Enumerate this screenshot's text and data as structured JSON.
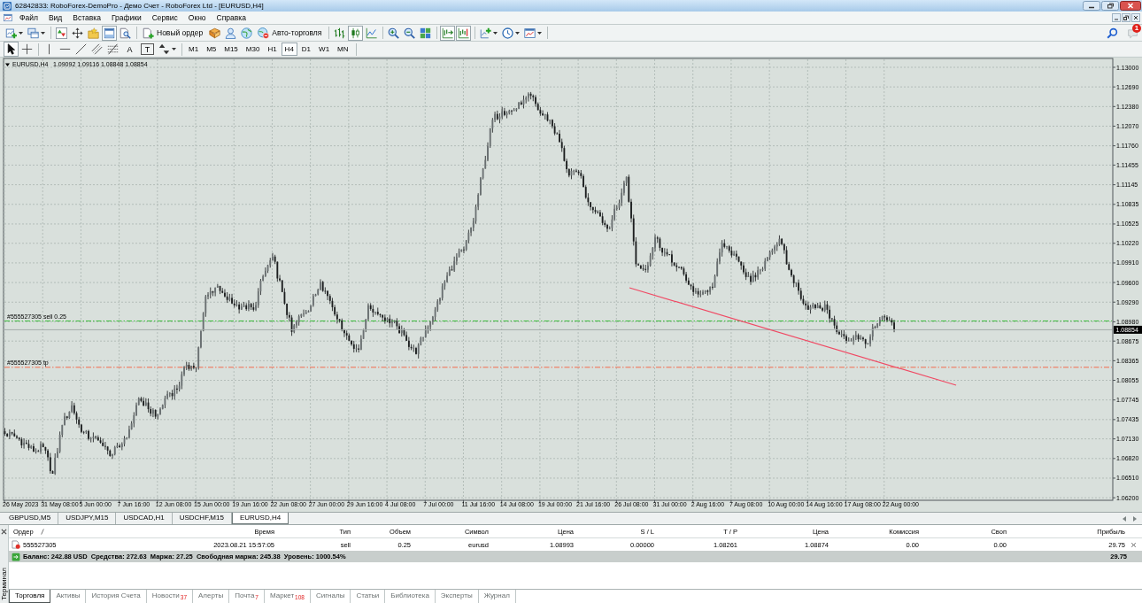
{
  "window": {
    "title": "62842833: RoboForex-DemoPro - Демо Счет - RoboForex Ltd - [EURUSD,H4]"
  },
  "menu": [
    "Файл",
    "Вид",
    "Вставка",
    "Графики",
    "Сервис",
    "Окно",
    "Справка"
  ],
  "main_toolbar": [
    {
      "kind": "icon",
      "pressed": false,
      "dropdown": true
    },
    {
      "kind": "icon",
      "pressed": false,
      "dropdown": true
    },
    {
      "kind": "separator"
    },
    {
      "kind": "icon",
      "pressed": false,
      "dropdown": false
    },
    {
      "kind": "icon",
      "pressed": false,
      "dropdown": false
    },
    {
      "kind": "icon",
      "pressed": false,
      "dropdown": false
    },
    {
      "kind": "icon",
      "pressed": true,
      "dropdown": false
    },
    {
      "kind": "icon",
      "pressed": false,
      "dropdown": false
    },
    {
      "kind": "separator"
    },
    {
      "kind": "text",
      "label": "Новый ордер",
      "pressed": false,
      "dropdown": false
    },
    {
      "kind": "icon",
      "pressed": false,
      "dropdown": false
    },
    {
      "kind": "icon",
      "pressed": false,
      "dropdown": false
    },
    {
      "kind": "icon",
      "pressed": false,
      "dropdown": false
    },
    {
      "kind": "text",
      "label": "Авто-торговля",
      "pressed": false,
      "dropdown": false
    },
    {
      "kind": "separator"
    },
    {
      "kind": "icon",
      "pressed": false,
      "dropdown": false
    },
    {
      "kind": "icon",
      "pressed": true,
      "dropdown": false
    },
    {
      "kind": "icon",
      "pressed": false,
      "dropdown": false
    },
    {
      "kind": "separator"
    },
    {
      "kind": "icon",
      "pressed": false,
      "dropdown": false
    },
    {
      "kind": "icon",
      "pressed": false,
      "dropdown": false
    },
    {
      "kind": "icon",
      "pressed": false,
      "dropdown": false
    },
    {
      "kind": "separator"
    },
    {
      "kind": "icon",
      "pressed": true,
      "dropdown": false
    },
    {
      "kind": "icon",
      "pressed": true,
      "dropdown": false
    },
    {
      "kind": "separator"
    },
    {
      "kind": "icon",
      "pressed": false,
      "dropdown": true
    },
    {
      "kind": "icon",
      "pressed": false,
      "dropdown": true
    },
    {
      "kind": "icon",
      "pressed": false,
      "dropdown": true
    },
    {
      "kind": "separator"
    }
  ],
  "notifications": {
    "count": "1"
  },
  "drawing_toolbar": [
    {
      "kind": "icon",
      "pressed": true,
      "dropdown": false
    },
    {
      "kind": "icon",
      "pressed": false,
      "dropdown": false
    },
    {
      "kind": "separator"
    },
    {
      "kind": "icon",
      "pressed": false,
      "dropdown": false
    },
    {
      "kind": "icon",
      "pressed": false,
      "dropdown": false
    },
    {
      "kind": "icon",
      "pressed": false,
      "dropdown": false
    },
    {
      "kind": "icon",
      "pressed": false,
      "dropdown": false
    },
    {
      "kind": "icon",
      "pressed": false,
      "dropdown": false
    },
    {
      "kind": "glyph",
      "label": "A",
      "pressed": false,
      "dropdown": false
    },
    {
      "kind": "boxed_glyph",
      "label": "T",
      "pressed": false,
      "dropdown": false
    },
    {
      "kind": "icon",
      "pressed": false,
      "dropdown": true
    },
    {
      "kind": "separator"
    }
  ],
  "timeframes": [
    {
      "label": "M1",
      "selected": false
    },
    {
      "label": "M5",
      "selected": false
    },
    {
      "label": "M15",
      "selected": false
    },
    {
      "label": "M30",
      "selected": false
    },
    {
      "label": "H1",
      "selected": false
    },
    {
      "label": "H4",
      "selected": true
    },
    {
      "label": "D1",
      "selected": false
    },
    {
      "label": "W1",
      "selected": false
    },
    {
      "label": "MN",
      "selected": false
    }
  ],
  "chart": {
    "ohlc": [
      "1.09092",
      "1.09116",
      "1.08848",
      "1.08854"
    ],
    "bid_price": "1.08854",
    "chart_data": {
      "type": "line",
      "title": "EURUSD,H4",
      "categories": [
        "26 May 2023",
        "31 May 08:00",
        "5 Jun 00:00",
        "7 Jun 16:00",
        "12 Jun 08:00",
        "15 Jun 00:00",
        "19 Jun 16:00",
        "22 Jun 08:00",
        "27 Jun 00:00",
        "29 Jun 16:00",
        "4 Jul 08:00",
        "7 Jul 00:00",
        "11 Jul 16:00",
        "14 Jul 08:00",
        "19 Jul 00:00",
        "21 Jul 16:00",
        "26 Jul 08:00",
        "31 Jul 00:00",
        "2 Aug 16:00",
        "7 Aug 08:00",
        "10 Aug 00:00",
        "14 Aug 16:00",
        "17 Aug 08:00",
        "22 Aug 00:00",
        null,
        null,
        null,
        null,
        null
      ],
      "ylim": [
        1.0616,
        1.1314
      ],
      "yticks": [
        {
          "value": 1.13,
          "label": "1.13000"
        },
        {
          "value": 1.1269,
          "label": "1.12690"
        },
        {
          "value": 1.1238,
          "label": "1.12380"
        },
        {
          "value": 1.1207,
          "label": "1.12070"
        },
        {
          "value": 1.1176,
          "label": "1.11760"
        },
        {
          "value": 1.11455,
          "label": "1.11455"
        },
        {
          "value": 1.11145,
          "label": "1.11145"
        },
        {
          "value": 1.10835,
          "label": "1.10835"
        },
        {
          "value": 1.10525,
          "label": "1.10525"
        },
        {
          "value": 1.1022,
          "label": "1.10220"
        },
        {
          "value": 1.0991,
          "label": "1.09910"
        },
        {
          "value": 1.096,
          "label": "1.09600"
        },
        {
          "value": 1.0929,
          "label": "1.09290"
        },
        {
          "value": 1.0898,
          "label": "1.08980"
        },
        {
          "value": 1.08675,
          "label": "1.08675"
        },
        {
          "value": 1.08365,
          "label": "1.08365"
        },
        {
          "value": 1.08055,
          "label": "1.08055"
        },
        {
          "value": 1.07745,
          "label": "1.07745"
        },
        {
          "value": 1.07435,
          "label": "1.07435"
        },
        {
          "value": 1.0713,
          "label": "1.07130"
        },
        {
          "value": 1.0682,
          "label": "1.06820"
        },
        {
          "value": 1.0651,
          "label": "1.06510"
        },
        {
          "value": 1.062,
          "label": "1.06200"
        }
      ],
      "grid": true,
      "ref_lines": [
        {
          "axis": "y",
          "value": 1.08993,
          "label": "#555527305 sell 0.25",
          "color": "#3fbf3f"
        },
        {
          "axis": "y",
          "value": 1.08261,
          "label": "#555527305 tp",
          "color": "#f26b4f"
        }
      ]
    }
  },
  "chart_tabs": [
    {
      "label": "GBPUSD,M5",
      "selected": false
    },
    {
      "label": "USDJPY,M15",
      "selected": false
    },
    {
      "label": "USDCAD,H1",
      "selected": false
    },
    {
      "label": "USDCHF,M15",
      "selected": false
    },
    {
      "label": "EURUSD,H4",
      "selected": true
    }
  ],
  "terminal": {
    "side_label": "Терминал",
    "columns": [
      {
        "label": "Ордер",
        "sorted": true
      },
      {
        "label": "Время",
        "sorted": false
      },
      {
        "label": "Тип",
        "sorted": false
      },
      {
        "label": "Объем",
        "sorted": false
      },
      {
        "label": "Символ",
        "sorted": false
      },
      {
        "label": "Цена",
        "sorted": false
      },
      {
        "label": "S / L",
        "sorted": false
      },
      {
        "label": "T / P",
        "sorted": false
      },
      {
        "label": "Цена",
        "sorted": false
      },
      {
        "label": "Комиссия",
        "sorted": false
      },
      {
        "label": "Своп",
        "sorted": false
      },
      {
        "label": "Прибыль",
        "sorted": false
      }
    ],
    "rows": [
      {
        "cells": [
          "555527305",
          "2023.08.21 15:57:05",
          "sell",
          "0.25",
          "eurusd",
          "1.08993",
          "0.00000",
          "1.08261",
          "1.08874",
          "0.00",
          "0.00",
          "29.75"
        ]
      }
    ],
    "summary": {
      "text": "Баланс: 242.88 USD  Средства: 272.63  Маржа: 27.25  Свободная маржа: 245.38  Уровень: 1000.54%",
      "profit": "29.75"
    },
    "tabs": [
      {
        "label": "Торговля",
        "selected": true
      },
      {
        "label": "Активы",
        "selected": false
      },
      {
        "label": "История Счета",
        "selected": false
      },
      {
        "label": "Новости",
        "count": "37",
        "selected": false
      },
      {
        "label": "Алерты",
        "selected": false
      },
      {
        "label": "Почта",
        "count": "7",
        "selected": false
      },
      {
        "label": "Маркет",
        "count": "108",
        "selected": false
      },
      {
        "label": "Сигналы",
        "selected": false
      },
      {
        "label": "Статьи",
        "selected": false
      },
      {
        "label": "Библиотека",
        "selected": false
      },
      {
        "label": "Эксперты",
        "selected": false
      },
      {
        "label": "Журнал",
        "selected": false
      }
    ]
  }
}
